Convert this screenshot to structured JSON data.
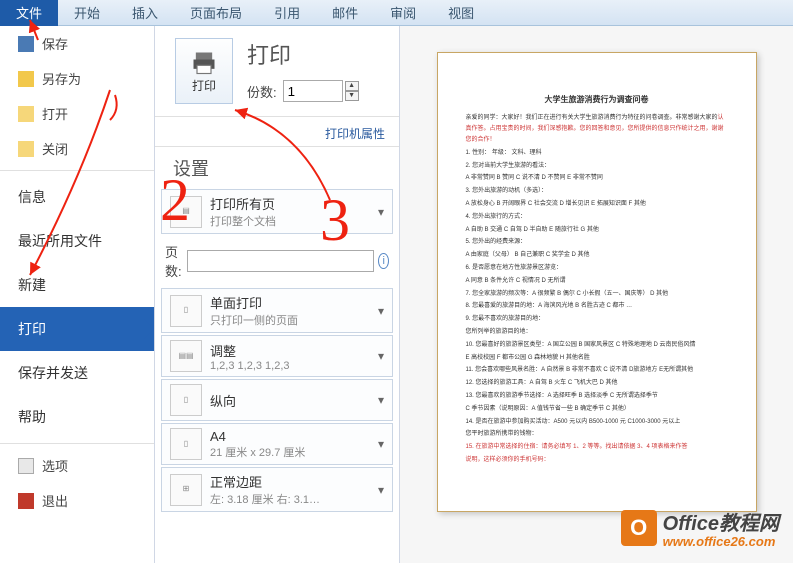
{
  "ribbon": {
    "tabs": [
      "文件",
      "开始",
      "插入",
      "页面布局",
      "引用",
      "邮件",
      "审阅",
      "视图"
    ],
    "activeIndex": 0
  },
  "sidebar": {
    "save": "保存",
    "saveAs": "另存为",
    "open": "打开",
    "close": "关闭",
    "info": "信息",
    "recent": "最近所用文件",
    "new": "新建",
    "print": "打印",
    "sendSave": "保存并发送",
    "help": "帮助",
    "options": "选项",
    "exit": "退出"
  },
  "print": {
    "title": "打印",
    "button": "打印",
    "copiesLabel": "份数:",
    "copiesValue": "1",
    "printerProps": "打印机属性",
    "settingsTitle": "设置",
    "printAllPages": {
      "label": "打印所有页",
      "sub": "打印整个文档"
    },
    "pagesLabel": "页数:",
    "pagesValue": "",
    "singleSide": {
      "label": "单面打印",
      "sub": "只打印一侧的页面"
    },
    "collate": {
      "label": "调整",
      "sub": "1,2,3   1,2,3   1,2,3"
    },
    "orientation": {
      "label": "纵向",
      "sub": ""
    },
    "paper": {
      "label": "A4",
      "sub": "21 厘米 x 29.7 厘米"
    },
    "margins": {
      "label": "正常边距",
      "sub": "左: 3.18 厘米   右: 3.1…"
    }
  },
  "preview": {
    "title": "大学生旅游消费行为调查问卷",
    "intro_p1": "亲爱的同学：大家好！我们正在进行有关大学生旅游消费行为特征的问卷调查。非常感谢大家的",
    "intro_p2": "认真作答。占用宝贵的时间，我们深感抱歉。您的回答和意见，您所提供的信息只作统计之用，谢谢您的合作！",
    "lines": [
      "1. 性别：        年级：                文科、理科",
      "2. 您对当前大学生旅游的看法：",
      "   A 非常赞同   B 赞同   C 说不清   D 不赞同   E 非常不赞同",
      "3. 您外出旅游的动机（多选）：",
      "   A 放松身心 B 开阔眼界 C 社会交流 D 增长见识 E 拓展知识面 F 其他",
      "4. 您外出旅行的方式：",
      "   A 自助   B 交通   C 自驾   D 半自助 E 随旅行社 G 其他",
      "5. 您外出的经费来源：",
      "   A 由家庭（父母） B 自己兼职   C 奖学金   D 其他",
      "6. 是否愿意在地方性旅游景区游览：",
      "   A 同意   B 条件允许   C 视情况 D 无所谓",
      "7. 您全家旅游的频次等：A 很频繁   B 偶尔   C 小长假（五一、国庆等）  D 其他",
      "8. 您最喜爱的旅游目的地：A 海滨风光地   B 名胜古迹   C 都市   …",
      "9. 您最不喜欢的旅游目的地：",
      "   您所列举的旅游目的地：",
      "10. 您最喜好的旅游景区类型：A 国立公园 B 国家风景区 C 特殊地理地 D 云南民俗风情",
      "    E 高校校园 F 都市公园 G 森林地貌 H 其他名胜",
      "11. 您会喜欢哪些风景名胜：A 自然景  B 非常不喜欢 C 说不清  D旅游地方 E无所谓其他",
      "12. 您选择的旅游工具：A 自驾   B 火车   C 飞机大巴 D 其他",
      "13. 您最喜欢的旅游季节选择：A 选择旺季  B 选择淡季  C 无所谓选择季节",
      "    C 季节因素（说明原因：A 值钱节省一些 B 确定季节 C 其他）",
      "14. 是否在旅游中参加购买活动：A500 元以内 B500-1000 元 C1000-3000 元以上",
      "    您平时旅游所携带的钱物："
    ],
    "redline1": "15. 在旅游中常选择的住宿：请务必填写 1、2 等等。找出请依据 3、4 项表格来作答",
    "redline2": "说明，这样必须你的手机号码："
  },
  "watermark": {
    "logo": "O",
    "text1": "Office教程网",
    "text2": "www.office26.com"
  },
  "annotations": {
    "n2": "2",
    "n3": "3"
  }
}
